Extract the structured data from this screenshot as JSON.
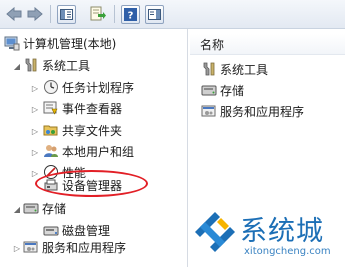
{
  "toolbar": {
    "buttons": [
      "back-arrow-icon",
      "forward-arrow-icon",
      "show-hide-tree-icon",
      "export-list-icon",
      "help-icon",
      "show-hide-action-pane-icon"
    ]
  },
  "tree": {
    "root": "计算机管理(本地)",
    "system_tools": "系统工具",
    "children": [
      "任务计划程序",
      "事件查看器",
      "共享文件夹",
      "本地用户和组",
      "性能",
      "设备管理器"
    ],
    "storage": "存储",
    "disk_management": "磁盘管理",
    "services": "服务和应用程序"
  },
  "right_pane": {
    "column_header": "名称",
    "items": [
      "系统工具",
      "存储",
      "服务和应用程序"
    ]
  },
  "colors": {
    "highlight": "#e21f26",
    "watermark": "#1c6fb6"
  },
  "watermark": {
    "brand": "系统城",
    "url": "xitongcheng.com"
  }
}
